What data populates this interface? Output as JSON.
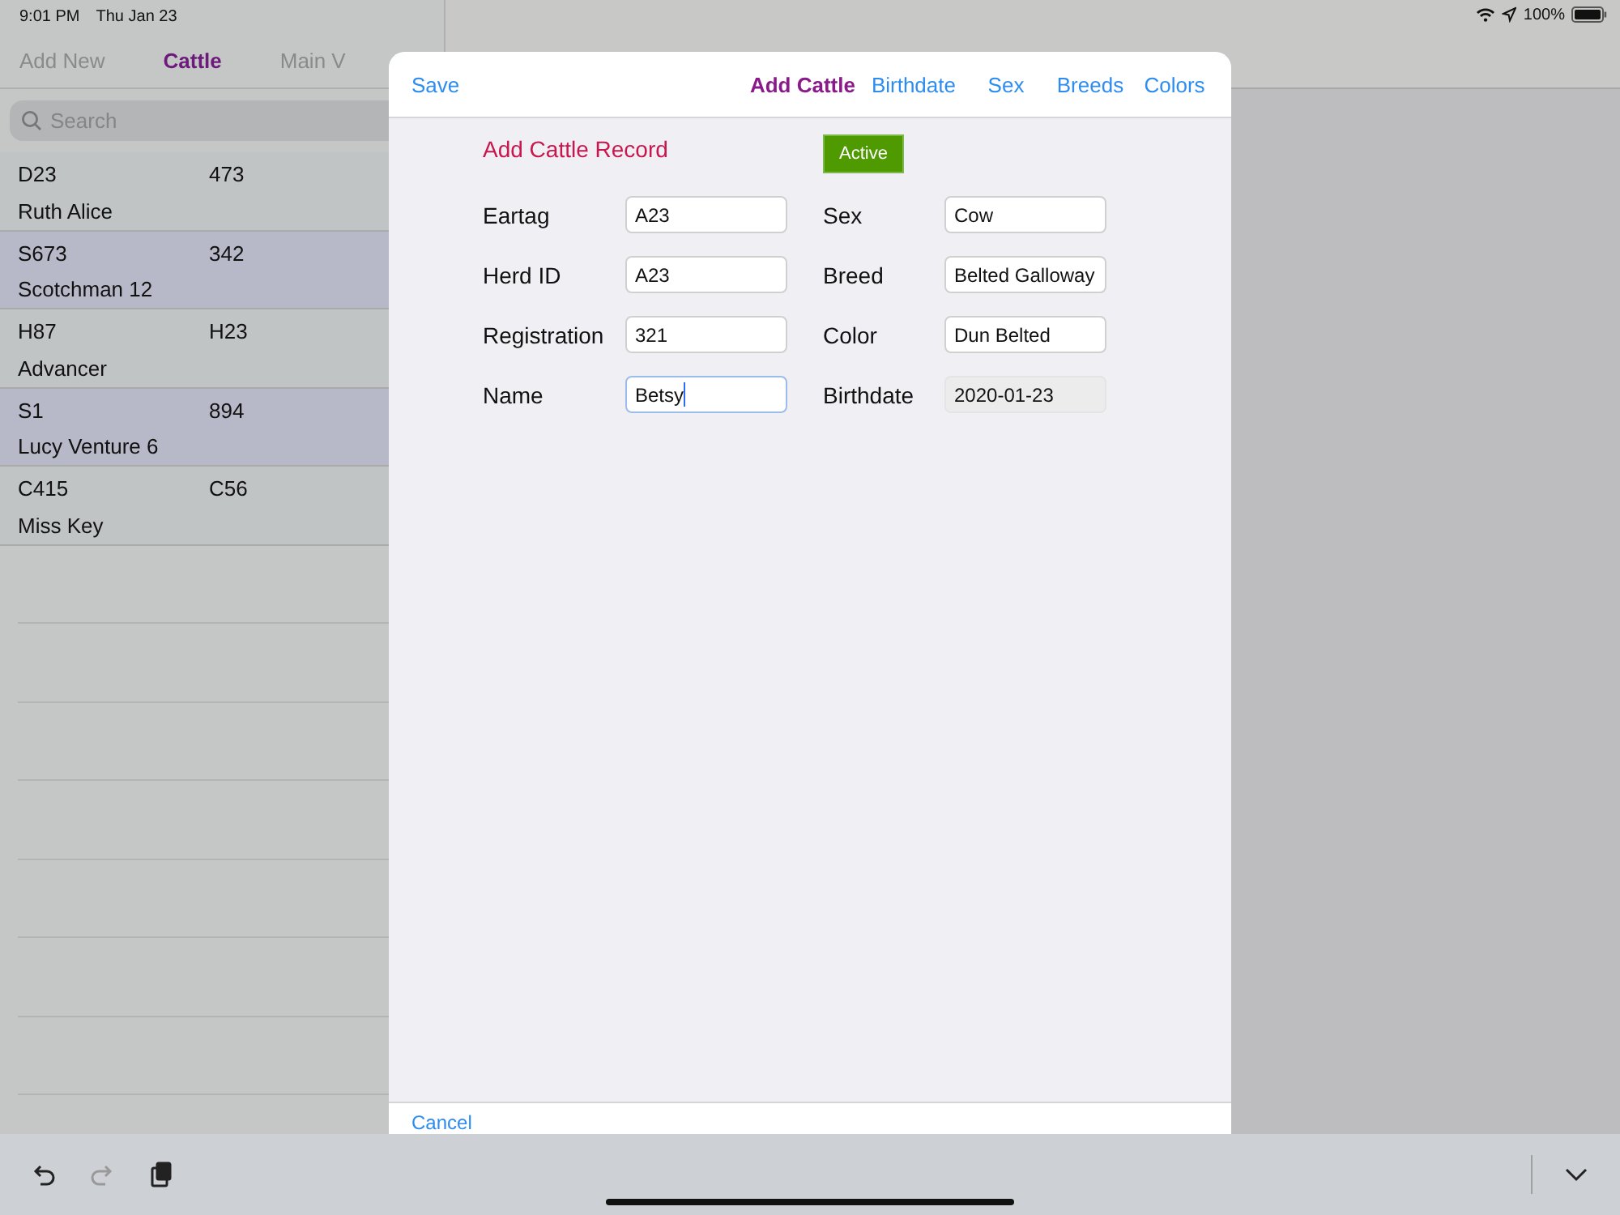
{
  "status_bar": {
    "time": "9:01 PM",
    "date": "Thu Jan 23",
    "battery": "100%"
  },
  "master_tabs": [
    {
      "label": "Add New",
      "selected": false
    },
    {
      "label": "Cattle",
      "selected": true
    },
    {
      "label": "Main V",
      "selected": false
    }
  ],
  "search": {
    "placeholder": "Search"
  },
  "cattle_list": [
    {
      "eartag": "D23",
      "herd_id": "473",
      "name": "Ruth Alice"
    },
    {
      "eartag": "S673",
      "herd_id": "342",
      "name": "Scotchman 12"
    },
    {
      "eartag": "H87",
      "herd_id": "H23",
      "name": "Advancer"
    },
    {
      "eartag": "S1",
      "herd_id": "894",
      "name": "Lucy Venture 6"
    },
    {
      "eartag": "C415",
      "herd_id": "C56",
      "name": "Miss Key"
    }
  ],
  "sheet": {
    "save": "Save",
    "nav": [
      {
        "label": "Add Cattle",
        "selected": true
      },
      {
        "label": "Birthdate",
        "selected": false
      },
      {
        "label": "Sex",
        "selected": false
      },
      {
        "label": "Breeds",
        "selected": false
      },
      {
        "label": "Colors",
        "selected": false
      }
    ],
    "title": "Add Cattle Record",
    "status_badge": "Active",
    "fields": [
      {
        "label": "Eartag",
        "value": "A23",
        "readonly": false,
        "focused": false
      },
      {
        "label": "Sex",
        "value": "Cow",
        "readonly": false,
        "focused": false
      },
      {
        "label": "Herd ID",
        "value": "A23",
        "readonly": false,
        "focused": false
      },
      {
        "label": "Breed",
        "value": "Belted Galloway",
        "readonly": false,
        "focused": false
      },
      {
        "label": "Registration",
        "value": "321",
        "readonly": false,
        "focused": false
      },
      {
        "label": "Color",
        "value": "Dun Belted",
        "readonly": false,
        "focused": false
      },
      {
        "label": "Name",
        "value": "Betsy",
        "readonly": false,
        "focused": true
      },
      {
        "label": "Birthdate",
        "value": "2020-01-23",
        "readonly": true,
        "focused": false
      }
    ],
    "cancel": "Cancel"
  }
}
